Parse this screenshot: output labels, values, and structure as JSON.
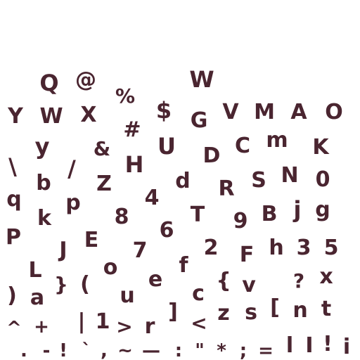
{
  "style": {
    "glyph_color": "#4a2530",
    "background": "#ffffff"
  },
  "glyphs": [
    "Q",
    "@",
    "%",
    "W",
    "Y",
    "W",
    "X",
    "$",
    "#",
    "G",
    "V",
    "M",
    "A",
    "O",
    "y",
    "&",
    "U",
    "D",
    "C",
    "m",
    "K",
    "\\",
    "/",
    "H",
    "b",
    "Z",
    "d",
    "S",
    "N",
    "0",
    "R",
    "q",
    "4",
    "k",
    "p",
    "8",
    "T",
    "9",
    "B",
    "j",
    "g",
    "P",
    "6",
    "E",
    "J",
    "7",
    "2",
    "F",
    "h",
    "3",
    "5",
    "L",
    "o",
    "f",
    "}",
    "(",
    "e",
    "{",
    "?",
    "x",
    ")",
    "a",
    "u",
    "c",
    "v",
    "]",
    "[",
    "n",
    "t",
    "|",
    "1",
    "z",
    "s",
    "^",
    "+",
    ">",
    "r",
    "<",
    ".",
    "-",
    "!",
    "`",
    ",",
    "~",
    "—",
    ":",
    "\"",
    "*",
    ";",
    "=",
    "l",
    "I",
    "!",
    "i"
  ]
}
